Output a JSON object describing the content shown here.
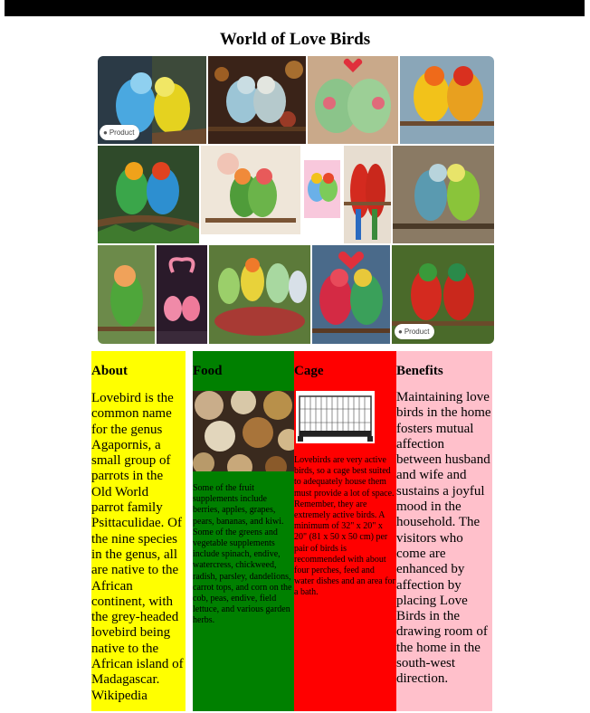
{
  "page": {
    "title": "World of Love Birds"
  },
  "gallery": {
    "tag_label": "Product",
    "tag_icon": "tag-icon",
    "images": [
      "budgie-pair",
      "lovebirds-bokeh",
      "cartoon-lovebirds",
      "yellow-red-lovebirds",
      "rainbow-lovebirds-branch",
      "lovebirds-heart-branch",
      "lovebird-pair-card",
      "macaws-pair",
      "budgies-kissing",
      "lovebird-green-peach",
      "flamingos-heart",
      "lovebirds-berries",
      "lovebirds-heart-kiss",
      "red-green-lovebirds"
    ]
  },
  "columns": {
    "about": {
      "heading": "About",
      "text": "Lovebird is the common name for the genus Agapornis, a small group of parrots in the Old World parrot family Psittaculidae. Of the nine species in the genus, all are native to the African continent, with the grey-headed lovebird being native to the African island of Madagascar. Wikipedia",
      "color": "#ffff00"
    },
    "food": {
      "heading": "Food",
      "text": "Some of the fruit supplements include berries, apples, grapes, pears, bananas, and kiwi. Some of the greens and vegetable supplements include spinach, endive, watercress, chickweed, radish, parsley, dandelions, carrot tops, and corn on the cob, peas, endive, field lettuce, and various garden herbs.",
      "color": "#008000"
    },
    "cage": {
      "heading": "Cage",
      "text": "Lovebirds are very active birds, so a cage best suited to adequately house them must provide a lot of space. Remember, they are extremely active birds. A minimum of 32\" x 20\" x 20\" (81 x 50 x 50 cm) per pair of birds is recommended with about four perches, feed and water dishes and an area for a bath.",
      "color": "#ff0000"
    },
    "benefits": {
      "heading": "Benefits",
      "text": "Maintaining love birds in the home fosters mutual affection between husband and wife and sustains a joyful mood in the household. The visitors who come are enhanced by affection by placing Love Birds in the drawing room of the home in the south-west direction.",
      "color": "#ffc0cb"
    }
  }
}
